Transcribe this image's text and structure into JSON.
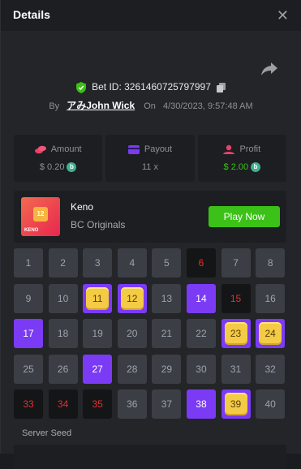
{
  "header": {
    "title": "Details",
    "close_icon": "close-icon"
  },
  "bet": {
    "id_label": "Bet ID: 3261460725797997",
    "by_label": "By",
    "username": "アみJohn Wick",
    "on_label": "On",
    "date": "4/30/2023, 9:57:48 AM"
  },
  "stats": {
    "amount": {
      "label": "Amount",
      "value": "$ 0.20",
      "icon": "coins-icon"
    },
    "payout": {
      "label": "Payout",
      "value": "11 x",
      "icon": "card-icon"
    },
    "profit": {
      "label": "Profit",
      "value": "$ 2.00",
      "icon": "profit-icon"
    }
  },
  "game": {
    "name": "Keno",
    "provider": "BC Originals",
    "play_label": "Play Now",
    "thumb_tile": "12",
    "thumb_text": "KENO"
  },
  "board": {
    "numbers": [
      "1",
      "2",
      "3",
      "4",
      "5",
      "6",
      "7",
      "8",
      "9",
      "10",
      "11",
      "12",
      "13",
      "14",
      "15",
      "16",
      "17",
      "18",
      "19",
      "20",
      "21",
      "22",
      "23",
      "24",
      "25",
      "26",
      "27",
      "28",
      "29",
      "30",
      "31",
      "32",
      "33",
      "34",
      "35",
      "36",
      "37",
      "38",
      "39",
      "40"
    ],
    "hits": [
      11,
      12,
      23,
      24,
      39
    ],
    "picks_missed": [
      14,
      17,
      27,
      38
    ],
    "drawn_missed": [
      6,
      15,
      33,
      34,
      35
    ]
  },
  "seed": {
    "label": "Server Seed"
  },
  "colors": {
    "accent": "#7b3bf5",
    "green": "#3bc117",
    "red": "#e0322f",
    "gem": "#f3cb44"
  }
}
